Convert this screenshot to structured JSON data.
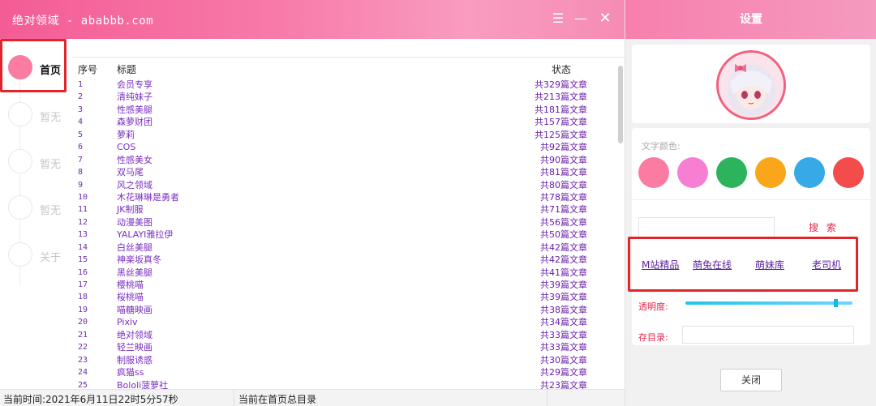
{
  "window": {
    "title": "绝对领域 - ababbb.com",
    "menu_icon": "menu-icon",
    "min_icon": "minimize-icon",
    "close_icon": "close-icon"
  },
  "sidebar": {
    "items": [
      {
        "label": "首页",
        "active": true
      },
      {
        "label": "暂无",
        "active": false
      },
      {
        "label": "暂无",
        "active": false
      },
      {
        "label": "暂无",
        "active": false
      },
      {
        "label": "关于",
        "active": false
      }
    ]
  },
  "list": {
    "headers": {
      "index": "序号",
      "title": "标题",
      "status": "状态"
    },
    "rows": [
      {
        "index": "1",
        "title": "会员专享",
        "status": "共329篇文章"
      },
      {
        "index": "2",
        "title": "清纯妹子",
        "status": "共213篇文章"
      },
      {
        "index": "3",
        "title": "性感美腿",
        "status": "共181篇文章"
      },
      {
        "index": "4",
        "title": "森萝财团",
        "status": "共157篇文章"
      },
      {
        "index": "5",
        "title": "萝莉",
        "status": "共125篇文章"
      },
      {
        "index": "6",
        "title": "COS",
        "status": "共92篇文章"
      },
      {
        "index": "7",
        "title": "性感美女",
        "status": "共90篇文章"
      },
      {
        "index": "8",
        "title": "双马尾",
        "status": "共81篇文章"
      },
      {
        "index": "9",
        "title": "风之领域",
        "status": "共80篇文章"
      },
      {
        "index": "10",
        "title": "木花琳琳是勇者",
        "status": "共78篇文章"
      },
      {
        "index": "11",
        "title": "JK制服",
        "status": "共71篇文章"
      },
      {
        "index": "12",
        "title": "动漫美图",
        "status": "共56篇文章"
      },
      {
        "index": "13",
        "title": "YALAYI雅拉伊",
        "status": "共50篇文章"
      },
      {
        "index": "14",
        "title": "白丝美腿",
        "status": "共42篇文章"
      },
      {
        "index": "15",
        "title": "神楽坂真冬",
        "status": "共42篇文章"
      },
      {
        "index": "16",
        "title": "黑丝美腿",
        "status": "共41篇文章"
      },
      {
        "index": "17",
        "title": "樱桃喵",
        "status": "共39篇文章"
      },
      {
        "index": "18",
        "title": "桜桃喵",
        "status": "共39篇文章"
      },
      {
        "index": "19",
        "title": "喵糖映画",
        "status": "共38篇文章"
      },
      {
        "index": "20",
        "title": "Pixiv",
        "status": "共34篇文章"
      },
      {
        "index": "21",
        "title": "绝对领域",
        "status": "共33篇文章"
      },
      {
        "index": "22",
        "title": "轻兰映画",
        "status": "共33篇文章"
      },
      {
        "index": "23",
        "title": "制服诱惑",
        "status": "共30篇文章"
      },
      {
        "index": "24",
        "title": "疯猫ss",
        "status": "共29篇文章"
      },
      {
        "index": "25",
        "title": "Bololi菠萝社",
        "status": "共23篇文章"
      }
    ]
  },
  "statusbar": {
    "time": "当前时间:2021年6月11日22时5分57秒",
    "location": "当前在首页总目录"
  },
  "settings": {
    "title": "设置",
    "color_label": "文字颜色:",
    "colors": [
      "#fb7ca3",
      "#f67ed3",
      "#2db35c",
      "#f9a61b",
      "#36a9e6",
      "#f44b4b"
    ],
    "search_label": "搜 索",
    "links": [
      "M站精品",
      "萌兔在线",
      "萌妹库",
      "老司机"
    ],
    "opacity_label": "透明度:",
    "opacity_level": 0.9,
    "dir_label": "存目录:",
    "close_label": "关闭"
  }
}
